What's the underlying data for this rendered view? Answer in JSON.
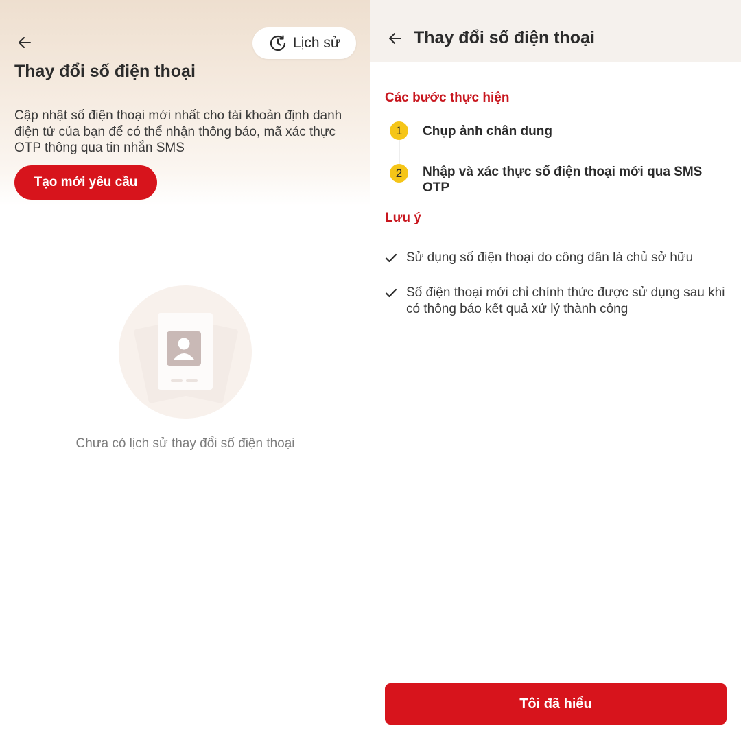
{
  "left_screen": {
    "title": "Thay đổi số điện thoại",
    "history_button_label": "Lịch sử",
    "description": "Cập nhật số điện thoại mới nhất cho tài khoản định danh điện tử của bạn để có thể nhận thông báo, mã xác thực OTP thông qua tin nhắn SMS",
    "create_request_label": "Tạo mới yêu cầu",
    "empty_state_text": "Chưa có lịch sử thay đổi số điện thoại",
    "icons": [
      "back-arrow-icon",
      "clock-history-icon",
      "id-card-illustration-icon"
    ]
  },
  "right_screen": {
    "header_title": "Thay đổi số điện thoại",
    "steps_heading": "Các bước thực hiện",
    "steps": [
      {
        "number": "1",
        "text": "Chụp ảnh chân dung"
      },
      {
        "number": "2",
        "text": "Nhập và xác thực số điện thoại mới qua SMS OTP"
      }
    ],
    "notes_heading": "Lưu ý",
    "notes": [
      "Sử dụng số điện thoại do công dân là chủ sở hữu",
      "Số điện thoại mới chỉ chính thức được sử dụng sau khi có thông báo kết quả xử lý thành công"
    ],
    "confirm_button_label": "Tôi đã hiểu",
    "icons": [
      "back-arrow-icon",
      "checkmark-icon"
    ]
  },
  "colors": {
    "primary_red": "#d7141c",
    "heading_red": "#c8161e",
    "step_badge_yellow": "#f5c518",
    "header_beige": "#f5f1ed"
  }
}
